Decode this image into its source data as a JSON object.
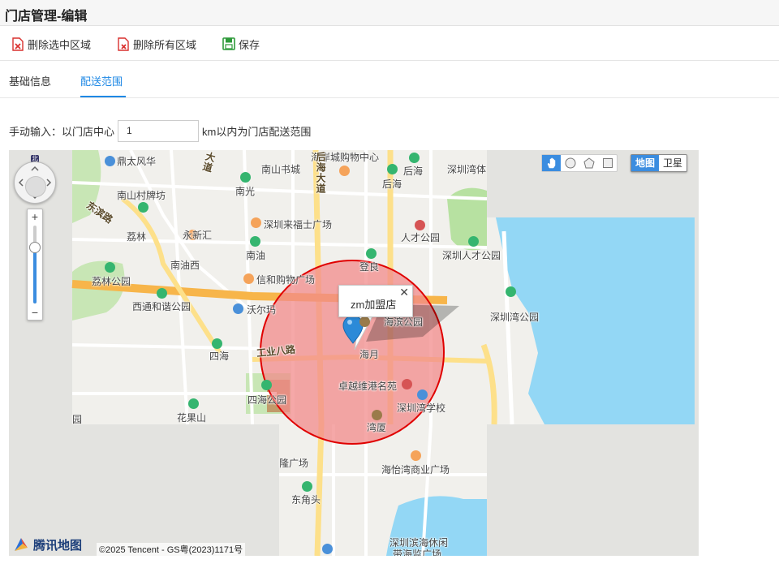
{
  "window": {
    "title": "门店管理-编辑"
  },
  "toolbar": {
    "delete_selected_label": "删除选中区域",
    "delete_all_label": "删除所有区域",
    "save_label": "保存"
  },
  "tabs": [
    {
      "label": "基础信息",
      "active": false
    },
    {
      "label": "配送范围",
      "active": true
    }
  ],
  "manual_input": {
    "prefix": "手动输入：以门店中心",
    "value": "1",
    "suffix": "km以内为门店配送范围"
  },
  "map": {
    "map_types": [
      {
        "label": "地图",
        "active": true
      },
      {
        "label": "卫星",
        "active": false
      }
    ],
    "draw_tools": [
      "hand-icon",
      "circle-icon",
      "polygon-icon",
      "rectangle-icon"
    ],
    "zoom": {
      "in": "+",
      "out": "−",
      "level_fraction": 0.72
    },
    "compass_label": "北",
    "info_window": {
      "text": "zm加盟店",
      "close": "✕"
    },
    "delivery_area": {
      "radius_km": 1,
      "fill": "#f28b8b",
      "stroke": "#e00000"
    },
    "logo_text": "腾讯地图",
    "copyright": "©2025 Tencent - GS粤(2023)1171号",
    "labels": {
      "l1": "鼎太风华",
      "l2": "南山书城",
      "l3": "海岸城购物中心",
      "l4": "后海",
      "l5": "深圳湾体",
      "l6": "南光",
      "l7": "后海",
      "l8": "南山村牌坊",
      "l9": "东滨路",
      "l10": "深圳来福士广场",
      "l11": "荔林",
      "l12": "永新汇",
      "l13": "人才公园",
      "l14": "南油西",
      "l15": "南油",
      "l16": "深圳人才公园",
      "l17": "荔林公园",
      "l18": "登良",
      "l19": "信和购物广场",
      "l20": "西通和谐公园",
      "l21": "沃尔玛",
      "l22": "深圳湾公园",
      "l23": "海滨公园",
      "l24": "工业八路",
      "l25": "四海",
      "l26": "海月",
      "l27": "卓越维港名苑",
      "l28": "四海公园",
      "l29": "深圳湾学校",
      "l30": "花果山",
      "l31": "园",
      "l32": "湾厦",
      "l33": "海怡湾商业广场",
      "l34": "隆广场",
      "l35": "东角头",
      "l36": "深圳滨海休闲",
      "l37": "带海监广场",
      "l38": "大道",
      "l39": "后海大道"
    }
  },
  "colors": {
    "accent": "#1e88e5",
    "water": "#93d7f5",
    "park": "#b7e1a1",
    "main_road": "#f7b54a",
    "delivery_fill": "#f28b8b",
    "delivery_stroke": "#e00000"
  }
}
